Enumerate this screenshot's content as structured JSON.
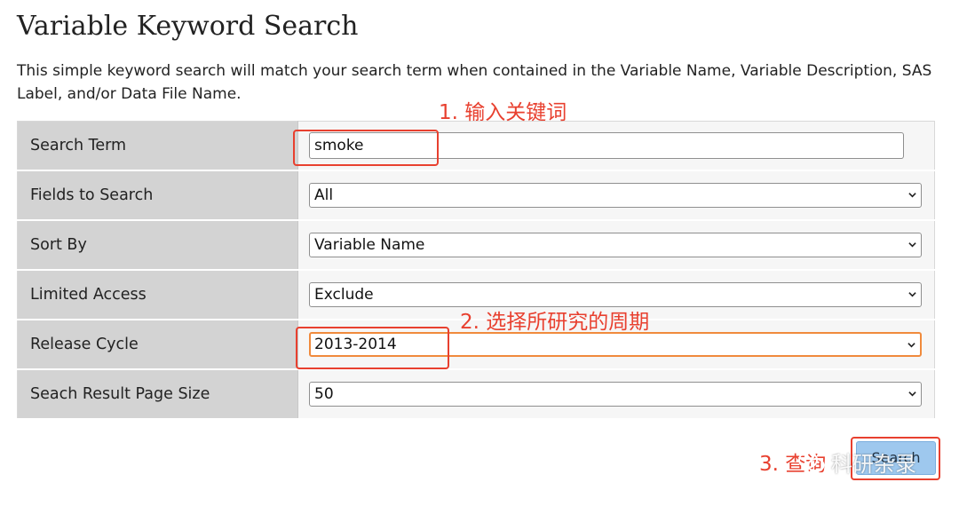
{
  "header": {
    "title": "Variable Keyword Search",
    "description": "This simple keyword search will match your search term when contained in the Variable Name, Variable Description, SAS Label, and/or Data File Name."
  },
  "form": {
    "rows": [
      {
        "label": "Search Term",
        "value": "smoke",
        "kind": "text"
      },
      {
        "label": "Fields to Search",
        "value": "All",
        "kind": "select"
      },
      {
        "label": "Sort By",
        "value": "Variable Name",
        "kind": "select"
      },
      {
        "label": "Limited Access",
        "value": "Exclude",
        "kind": "select"
      },
      {
        "label": "Release Cycle",
        "value": "2013-2014",
        "kind": "select"
      },
      {
        "label": "Seach Result Page Size",
        "value": "50",
        "kind": "select"
      }
    ],
    "search_button_label": "Search"
  },
  "annotations": {
    "step1": "1. 输入关键词",
    "step2": "2. 选择所研究的周期",
    "step3": "3. 查询"
  },
  "watermark": {
    "text": "科研杂录"
  },
  "colors": {
    "annotation": "#e8402f",
    "label_bg": "#d3d3d3",
    "field_bg": "#f6f6f6",
    "focus_border": "#f08a3c",
    "button_bg": "#9ec8ee"
  }
}
